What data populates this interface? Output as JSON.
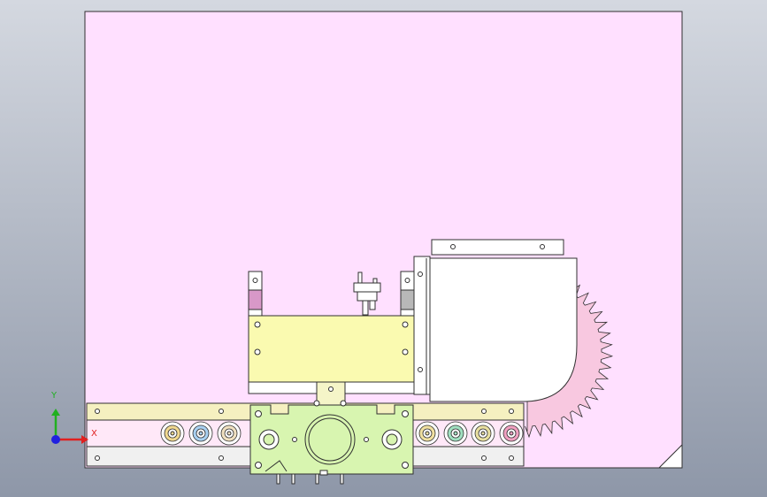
{
  "viewport": {
    "background_top": "#d4d8e0",
    "background_bottom": "#8e97a8"
  },
  "sheet": {
    "fill": "#ffe0ff",
    "stroke": "#303030"
  },
  "parts": {
    "base_plate_fill": "#f5f5c8",
    "upper_rail_fill": "#f5f0c0",
    "lower_rail_fill": "#f0f0f0",
    "yellow_block_fill": "#fafab0",
    "carriage_fill": "#d8f5b0",
    "hopper_fill": "#ffffff",
    "sprocket_fill": "#f8c8e0",
    "bracket_left_fill": "#d898c8",
    "bracket_right_fill": "#b8b8b8"
  },
  "rollers": {
    "colors": [
      "#f0d890",
      "#a8d0f0",
      "#f0e0c0",
      "#f0e0a0",
      "#a0e0c0",
      "#e8e0a0",
      "#f0a0c0"
    ]
  },
  "triad": {
    "x_label": "X",
    "y_label": "Y",
    "x_color": "#e02020",
    "y_color": "#20b020",
    "z_color": "#2020e0"
  }
}
